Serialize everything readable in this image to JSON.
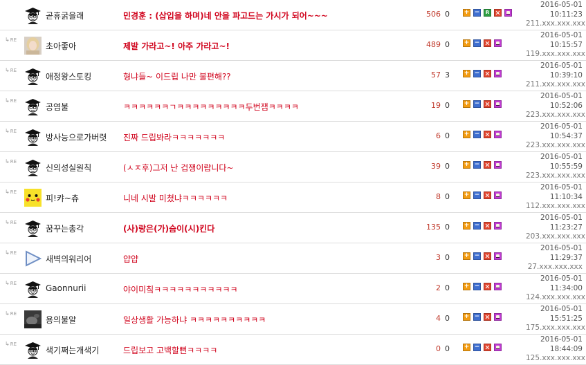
{
  "colors": {
    "subject": "#d0021b",
    "views": "#c0392b",
    "plus": "#f39c12",
    "minus": "#3f6fd0",
    "recommend": "#2e9e43",
    "delete": "#e0452e",
    "emoticon": "#c13bd3"
  },
  "reply_label": "RE",
  "buttons": {
    "plus": "+",
    "minus": "−",
    "recommend": "R"
  },
  "comments": [
    {
      "is_reply": false,
      "avatar": "graduate-avatar",
      "nickname": "곧휴굵을래",
      "subject": "민경훈 : (삽입을 하며)네 안을 파고드는 가시가 되어~~~",
      "bold": true,
      "views": "506",
      "votes": "0",
      "recommend_button": true,
      "date": "2016-05-01",
      "time": "10:11:23",
      "ip": "211.xxx.xxx.xxx"
    },
    {
      "is_reply": true,
      "avatar": "photo-blonde-avatar",
      "nickname": "초아좋아",
      "subject": "제발 가라고~! 아주 가라고~!",
      "bold": true,
      "views": "489",
      "votes": "0",
      "recommend_button": false,
      "date": "2016-05-01",
      "time": "10:15:57",
      "ip": "119.xxx.xxx.xxx"
    },
    {
      "is_reply": true,
      "avatar": "graduate-avatar",
      "nickname": "애정왕스토킹",
      "subject": "형냐들~ 이드립 나만 불편해??",
      "bold": false,
      "views": "57",
      "votes": "3",
      "recommend_button": false,
      "date": "2016-05-01",
      "time": "10:39:10",
      "ip": "211.xxx.xxx.xxx"
    },
    {
      "is_reply": true,
      "avatar": "graduate-avatar",
      "nickname": "공염불",
      "subject": "ㅋㅋㅋㅋㅋㅋㄱㅋㅋㅋㅋㅋㅋㅋㅋㅋ두번잼ㅋㅋㅋㅋ",
      "bold": false,
      "views": "19",
      "votes": "0",
      "recommend_button": false,
      "date": "2016-05-01",
      "time": "10:52:06",
      "ip": "223.xxx.xxx.xxx"
    },
    {
      "is_reply": true,
      "avatar": "graduate-avatar",
      "nickname": "방사능으로가버렷",
      "subject": "진짜 드립봐라ㅋㅋㅋㅋㅋㅋㅋ",
      "bold": false,
      "views": "6",
      "votes": "0",
      "recommend_button": false,
      "date": "2016-05-01",
      "time": "10:54:37",
      "ip": "223.xxx.xxx.xxx"
    },
    {
      "is_reply": true,
      "avatar": "graduate-avatar",
      "nickname": "신의성실원칙",
      "subject": "(ㅅㅈ후)그저 난 겁쟁이랍니다~",
      "bold": false,
      "views": "39",
      "votes": "0",
      "recommend_button": false,
      "date": "2016-05-01",
      "time": "10:55:59",
      "ip": "223.xxx.xxx.xxx"
    },
    {
      "is_reply": true,
      "avatar": "pikachu-avatar",
      "nickname": "피!캬~츄",
      "subject": "니네 시발 미쳤냐ㅋㅋㅋㅋㅋㅋ",
      "bold": false,
      "views": "8",
      "votes": "0",
      "recommend_button": false,
      "date": "2016-05-01",
      "time": "11:10:34",
      "ip": "112.xxx.xxx.xxx"
    },
    {
      "is_reply": true,
      "avatar": "graduate-avatar",
      "nickname": "꿈꾸는총각",
      "subject": "(사)랑은(가)슴이(시)킨다",
      "bold": true,
      "views": "135",
      "votes": "0",
      "recommend_button": false,
      "date": "2016-05-01",
      "time": "11:23:27",
      "ip": "203.xxx.xxx.xxx"
    },
    {
      "is_reply": true,
      "avatar": "play-triangle-avatar",
      "nickname": "새벽의워리어",
      "subject": "얍얍",
      "bold": false,
      "views": "3",
      "votes": "0",
      "recommend_button": false,
      "date": "2016-05-01",
      "time": "11:29:37",
      "ip": "27.xxx.xxx.xxx"
    },
    {
      "is_reply": true,
      "avatar": "graduate-avatar",
      "nickname": "Gaonnurii",
      "subject": "야이미칰ㅋㅋㅋㅋㅋㅋㅋㅋㅋㅋㅋ",
      "bold": false,
      "views": "2",
      "votes": "0",
      "recommend_button": false,
      "date": "2016-05-01",
      "time": "11:34:00",
      "ip": "124.xxx.xxx.xxx"
    },
    {
      "is_reply": true,
      "avatar": "dark-photo-avatar",
      "nickname": "용의불알",
      "subject": "일상생활 가능하냐 ㅋㅋㅋㅋㅋㅋㅋㅋㅋㅋ",
      "bold": false,
      "views": "4",
      "votes": "0",
      "recommend_button": false,
      "date": "2016-05-01",
      "time": "15:51:25",
      "ip": "175.xxx.xxx.xxx"
    },
    {
      "is_reply": true,
      "avatar": "graduate-avatar",
      "nickname": "색기쩌는개색기",
      "subject": "드립보고 고백할뻔ㅋㅋㅋㅋ",
      "bold": false,
      "views": "0",
      "votes": "0",
      "recommend_button": false,
      "date": "2016-05-01",
      "time": "18:44:09",
      "ip": "125.xxx.xxx.xxx"
    }
  ]
}
